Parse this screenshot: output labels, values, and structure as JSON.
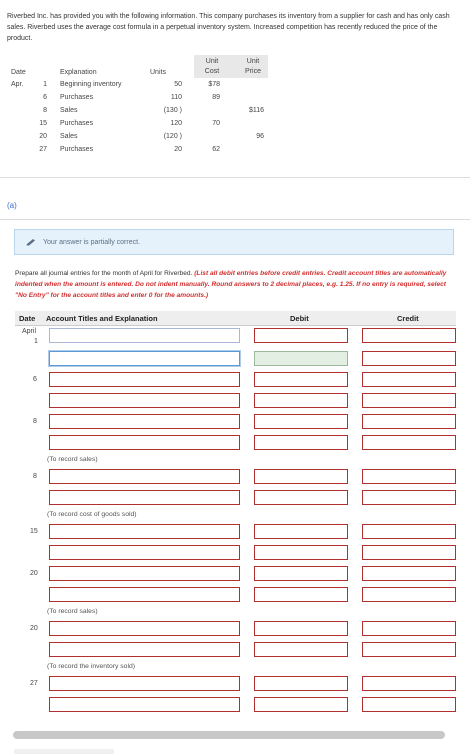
{
  "intro": "Riverbed Inc. has provided you with the following information. This company purchases its inventory from a supplier for cash and has only cash sales. Riverbed uses the average cost formula in a perpetual inventory system. Increased competition has recently reduced the price of the product.",
  "table": {
    "headers": {
      "date": "Date",
      "explanation": "Explanation",
      "units": "Units",
      "unit_cost": "Unit\nCost",
      "unit_price": "Unit\nPrice"
    },
    "rows": [
      {
        "month": "Apr.",
        "day": "1",
        "explanation": "Beginning inventory",
        "units": "50",
        "cost": "$78",
        "price": ""
      },
      {
        "month": "",
        "day": "6",
        "explanation": "Purchases",
        "units": "110",
        "cost": "89",
        "price": ""
      },
      {
        "month": "",
        "day": "8",
        "explanation": "Sales",
        "units": "(130 )",
        "cost": "",
        "price": "$116"
      },
      {
        "month": "",
        "day": "15",
        "explanation": "Purchases",
        "units": "120",
        "cost": "70",
        "price": ""
      },
      {
        "month": "",
        "day": "20",
        "explanation": "Sales",
        "units": "(120 )",
        "cost": "",
        "price": "96"
      },
      {
        "month": "",
        "day": "27",
        "explanation": "Purchases",
        "units": "20",
        "cost": "62",
        "price": ""
      }
    ]
  },
  "part_label": "(a)",
  "banner": "Your answer is partially correct.",
  "instructions_plain": "Prepare all journal entries for the month of April for Riverbed. ",
  "instructions_red": "(List all debit entries before credit entries. Credit account titles are automatically indented when the amount is entered. Do not indent manually. Round answers to 2 decimal places, e.g. 1.25. If no entry is required, select \"No Entry\" for the account titles and enter 0 for the amounts.)",
  "journal": {
    "headers": {
      "date": "Date",
      "account": "Account Titles and Explanation",
      "debit": "Debit",
      "credit": "Credit"
    },
    "dates": {
      "april": "April",
      "d1": "1",
      "d6": "6",
      "d8a": "8",
      "d8b": "8",
      "d15": "15",
      "d20a": "20",
      "d20b": "20",
      "d27": "27"
    },
    "notes": {
      "sales": "(To record sales)",
      "cogs": "(To record cost of goods sold)",
      "sales2": "(To record sales)",
      "inv_sold": "(To record the inventory sold)"
    }
  }
}
